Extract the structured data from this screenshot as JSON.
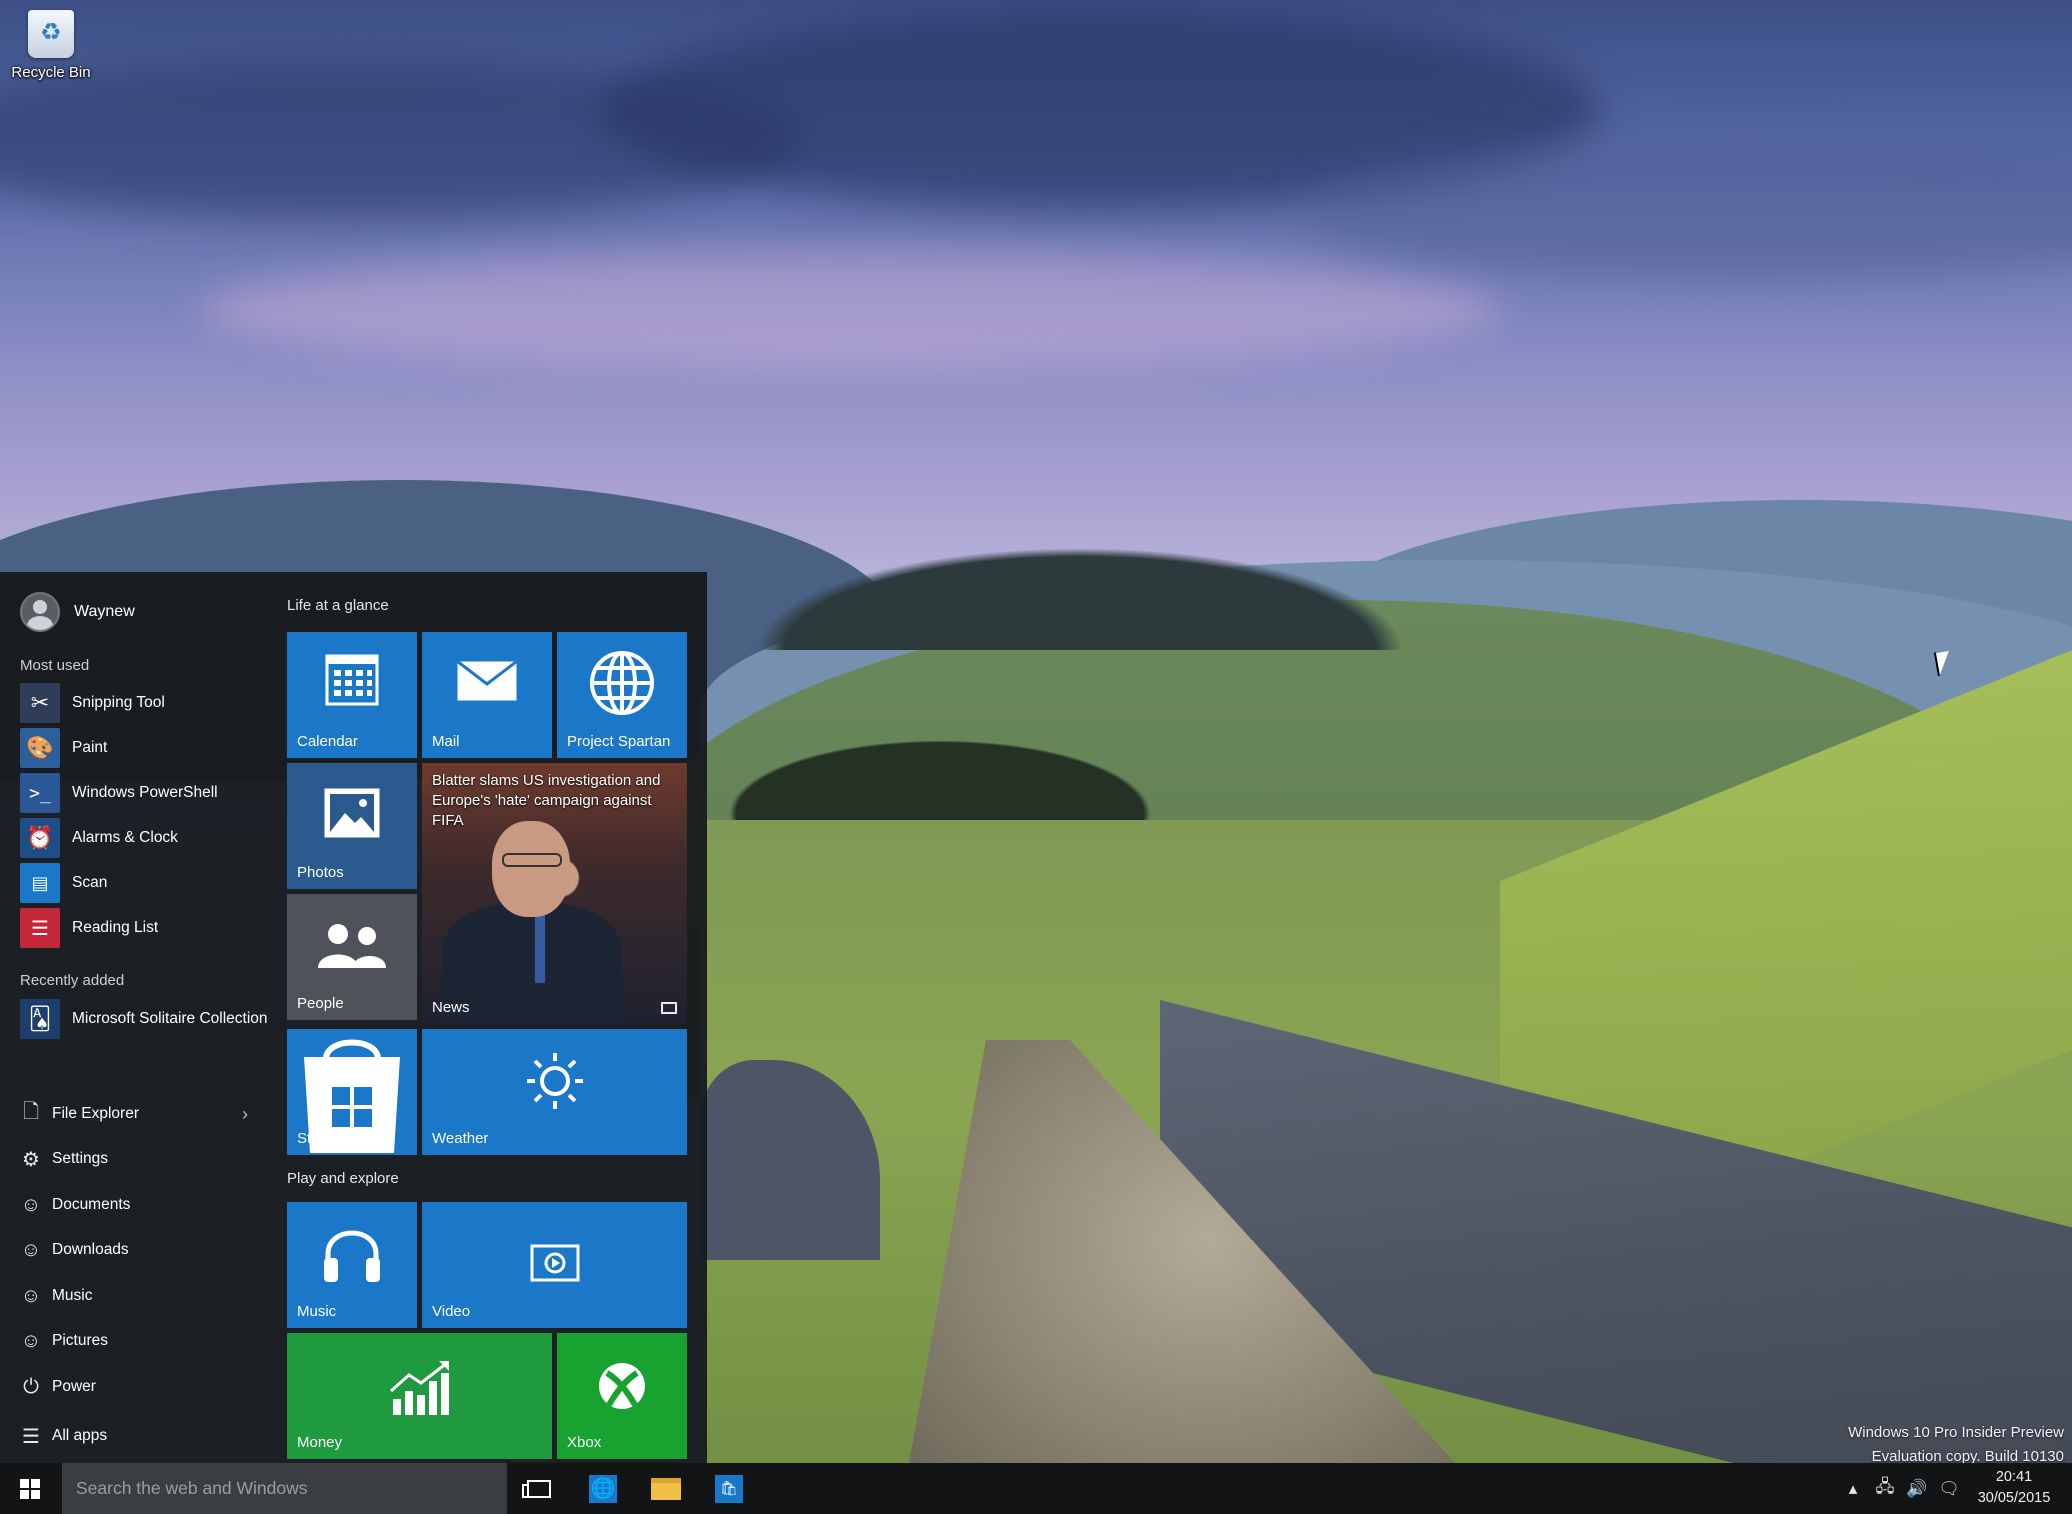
{
  "desktop": {
    "recycle_bin_label": "Recycle Bin",
    "watermark_line1": "Windows 10 Pro Insider Preview",
    "watermark_line2": "Evaluation copy. Build 10130"
  },
  "start_menu": {
    "user_name": "Waynew",
    "most_used_title": "Most used",
    "most_used": [
      {
        "label": "Snipping Tool",
        "icon": "scissors-icon",
        "color": "#3a4b6b"
      },
      {
        "label": "Paint",
        "icon": "palette-icon",
        "color": "#2d5f9a"
      },
      {
        "label": "Windows PowerShell",
        "icon": "terminal-icon",
        "color": "#2b5797"
      },
      {
        "label": "Alarms & Clock",
        "icon": "alarm-clock-icon",
        "color": "#1e4e86"
      },
      {
        "label": "Scan",
        "icon": "scanner-icon",
        "color": "#1b78c9"
      },
      {
        "label": "Reading List",
        "icon": "reading-list-icon",
        "color": "#c4273a"
      }
    ],
    "recently_added_title": "Recently added",
    "recently_added": [
      {
        "label": "Microsoft Solitaire Collection",
        "icon": "cards-icon",
        "color": "#1e3f6e"
      }
    ],
    "places": [
      {
        "label": "File Explorer",
        "icon": "file-explorer-icon",
        "has_chevron": true
      },
      {
        "label": "Settings",
        "icon": "gear-icon"
      },
      {
        "label": "Documents",
        "icon": "documents-icon"
      },
      {
        "label": "Downloads",
        "icon": "downloads-icon"
      },
      {
        "label": "Music",
        "icon": "music-icon"
      },
      {
        "label": "Pictures",
        "icon": "pictures-icon"
      },
      {
        "label": "Power",
        "icon": "power-icon"
      },
      {
        "label": "All apps",
        "icon": "list-icon"
      }
    ],
    "group1_title": "Life at a glance",
    "group2_title": "Play and explore",
    "tiles": {
      "calendar": "Calendar",
      "mail": "Mail",
      "project_spartan": "Project Spartan",
      "photos": "Photos",
      "news": "News",
      "news_headline": "Blatter slams US investigation and Europe's 'hate' campaign against FIFA",
      "people": "People",
      "store": "Store",
      "weather": "Weather",
      "music": "Music",
      "video": "Video",
      "money": "Money",
      "xbox": "Xbox"
    },
    "tile_colors": {
      "blue": "#1b78c9",
      "slate": "#2b5a8f",
      "gray": "#4f5258",
      "green": "#1f9a3f",
      "xbox_green": "#18a331"
    }
  },
  "taskbar": {
    "search_placeholder": "Search the web and Windows",
    "time": "20:41",
    "date": "30/05/2015"
  }
}
